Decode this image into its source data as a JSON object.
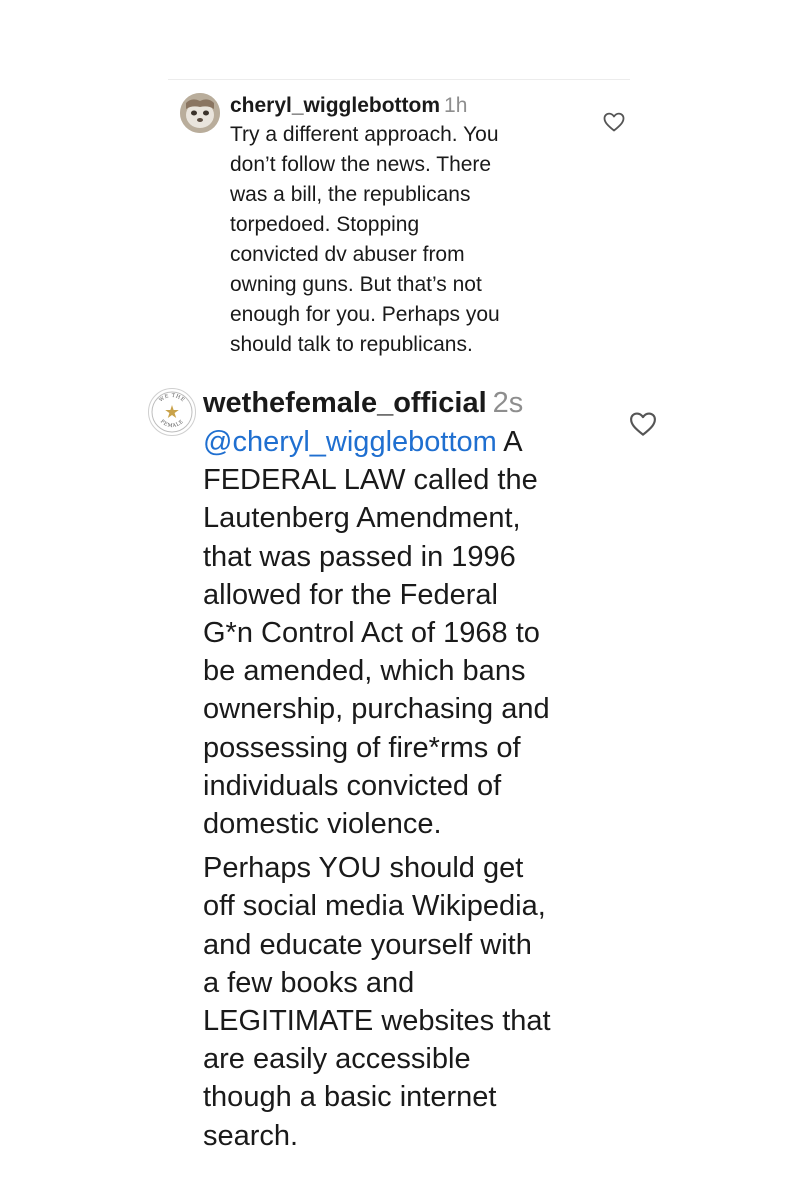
{
  "comments": [
    {
      "username": "cheryl_wigglebottom",
      "time": "1h",
      "lines": [
        "Try a different approach. You",
        "don’t follow the news. There",
        "was a bill, the republicans",
        "torpedoed. Stopping",
        "convicted dv abuser from",
        "owning guns. But that’s not",
        "enough for you. Perhaps you",
        "should talk to republicans."
      ],
      "avatar_icon": "profile-photo-icon",
      "like_icon": "heart-outline-icon"
    },
    {
      "username": "wethefemale_official",
      "time": "2s",
      "mention": "@cheryl_wigglebottom",
      "mention_tail": " A",
      "paragraph1_lines": [
        "FEDERAL LAW called the",
        "Lautenberg Amendment,",
        "that was passed in 1996",
        "allowed for the Federal",
        "G*n  Control Act of 1968 to",
        "be amended, which bans",
        "ownership, purchasing and",
        "possessing of fire*rms of",
        "individuals convicted of",
        "domestic violence."
      ],
      "paragraph2_lines": [
        "Perhaps YOU should get",
        "off social media Wikipedia,",
        "and educate yourself with",
        "a few books and",
        "LEGITIMATE websites that",
        "are easily accessible",
        "though a basic internet",
        "search."
      ],
      "avatar_icon": "we-the-female-logo-icon",
      "avatar_logo_text": "WE THE FEMALE",
      "like_icon": "heart-outline-icon"
    }
  ],
  "colors": {
    "text": "#1a1a1a",
    "muted": "#8e8e8e",
    "mention": "#1f6fd0",
    "background": "#ffffff"
  }
}
